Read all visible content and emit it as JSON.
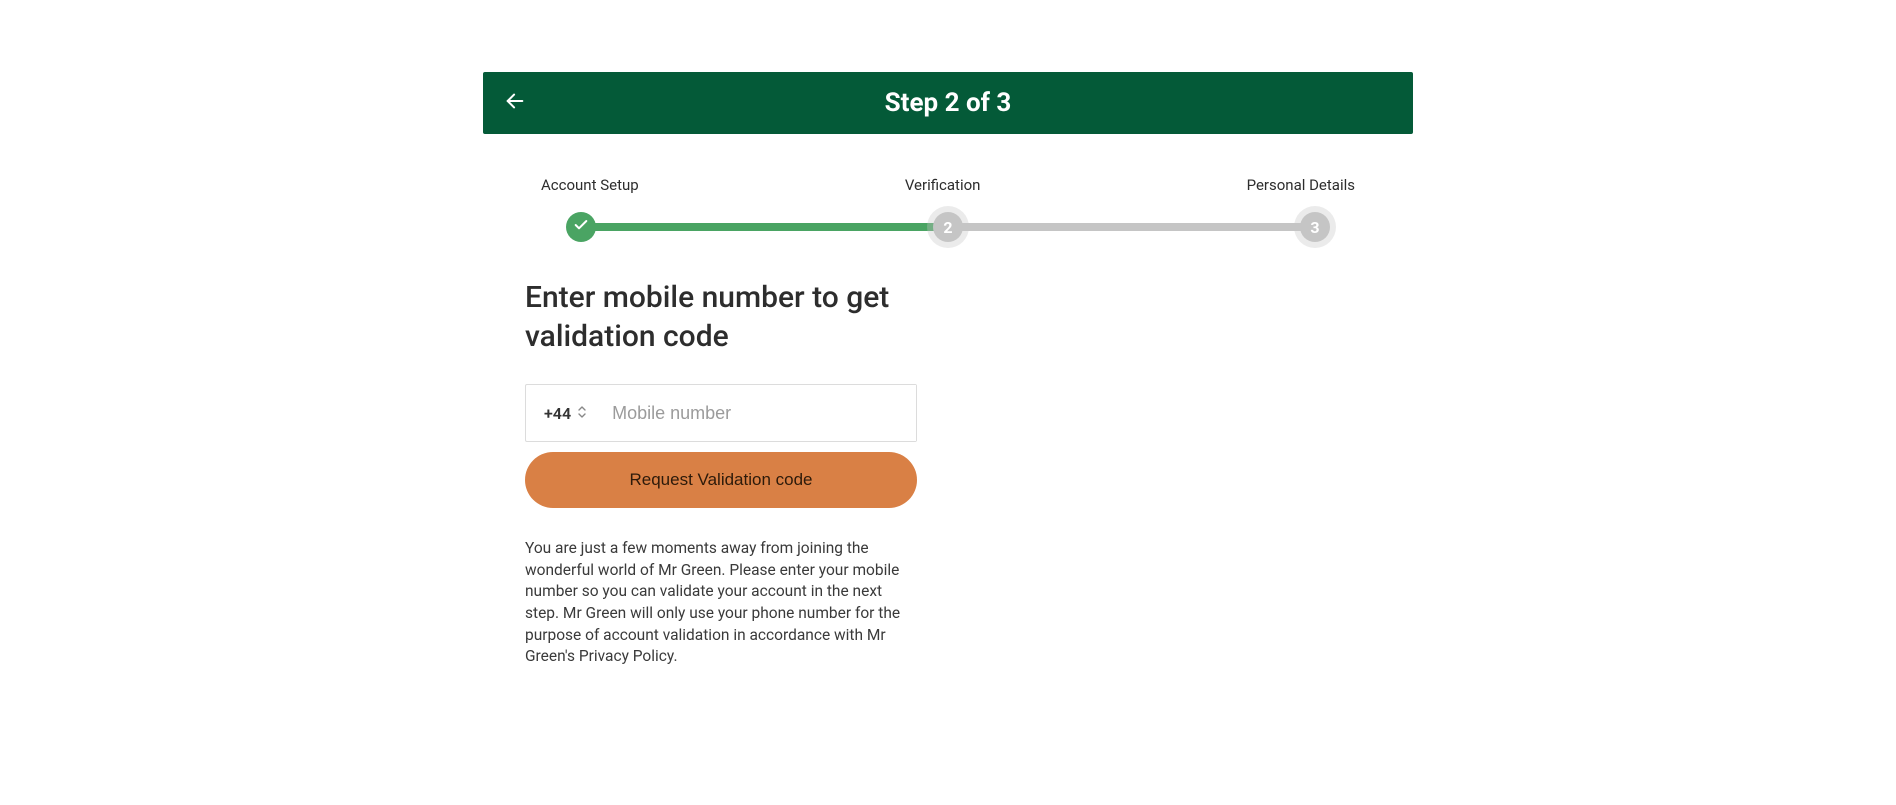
{
  "header": {
    "title": "Step 2 of 3"
  },
  "progress": {
    "steps": [
      {
        "label": "Account Setup",
        "state": "done"
      },
      {
        "label": "Verification",
        "state": "current",
        "num": "2"
      },
      {
        "label": "Personal Details",
        "state": "future",
        "num": "3"
      }
    ]
  },
  "form": {
    "heading": "Enter mobile number to get validation code",
    "country_code": "+44",
    "phone_value": "",
    "phone_placeholder": "Mobile number",
    "cta_label": "Request Validation code",
    "info": "You are just a few moments away from joining the wonderful world of Mr Green. Please enter your mobile number so you can validate your account in the next step. Mr Green will only use your phone number for the purpose of account validation in accordance with Mr Green's Privacy Policy."
  },
  "colors": {
    "brand_green": "#045a38",
    "progress_green": "#4aa463",
    "cta_orange": "#d98045",
    "grey": "#c5c5c5"
  }
}
